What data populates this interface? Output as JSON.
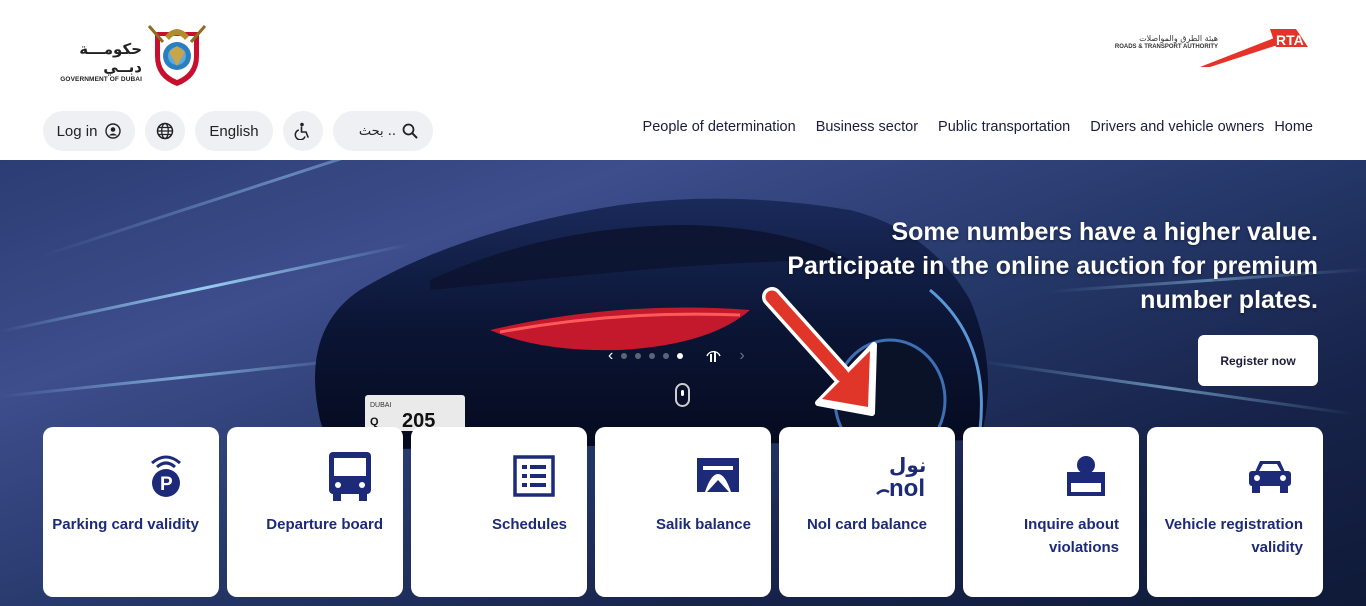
{
  "header": {
    "gov_logo": {
      "arabic": "حكومـــة دبــي",
      "english": "GOVERNMENT OF DUBAI"
    },
    "rta_logo": {
      "arabic": "هيئة الطرق والمواصلات",
      "english": "ROADS & TRANSPORT AUTHORITY",
      "mark": "RTA"
    },
    "login_label": "Log in",
    "language_label": "English",
    "search_placeholder": "بحث ..",
    "nav": [
      "People of determination",
      "Business sector",
      "Public transportation",
      "Drivers and vehicle owners",
      "Home"
    ]
  },
  "hero": {
    "title_lines": [
      "Some numbers have a higher value.",
      "Participate in the online auction for premium",
      "number plates."
    ],
    "register_label": "Register now",
    "plate_city": "DUBAI",
    "plate_letter": "Q",
    "plate_number": "205",
    "slides": 5,
    "active_slide": 5
  },
  "services": [
    {
      "label": "Parking card validity",
      "icon": "parking-icon"
    },
    {
      "label": "Departure board",
      "icon": "bus-icon"
    },
    {
      "label": "Schedules",
      "icon": "schedule-icon"
    },
    {
      "label": "Salik balance",
      "icon": "salik-gate-icon"
    },
    {
      "label": "Nol card balance",
      "icon": "nol-logo-icon",
      "logo_ar": "نول",
      "logo_en": "nol"
    },
    {
      "label": "Inquire about violations",
      "icon": "violations-icon"
    },
    {
      "label": "Vehicle registration validity",
      "icon": "car-icon"
    }
  ],
  "colors": {
    "brand_blue": "#1d2a78",
    "rta_red": "#e63329",
    "annotation_arrow": "#e0362a",
    "pill_bg": "#eff0f3"
  }
}
